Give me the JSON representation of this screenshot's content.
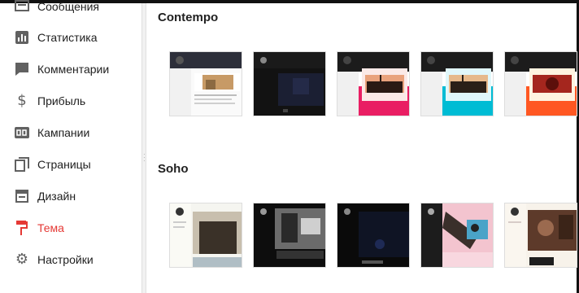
{
  "sidebar": {
    "items": [
      {
        "label": "Сообщения",
        "icon": "message-icon"
      },
      {
        "label": "Статистика",
        "icon": "stats-icon"
      },
      {
        "label": "Комментарии",
        "icon": "comment-icon"
      },
      {
        "label": "Прибыль",
        "icon": "dollar-icon"
      },
      {
        "label": "Кампании",
        "icon": "ad-icon"
      },
      {
        "label": "Страницы",
        "icon": "pages-icon"
      },
      {
        "label": "Дизайн",
        "icon": "layout-icon"
      },
      {
        "label": "Тема",
        "icon": "paint-roller-icon",
        "active": true
      },
      {
        "label": "Настройки",
        "icon": "gear-icon"
      }
    ]
  },
  "colors": {
    "accent": "#e53935",
    "icon": "#616161"
  },
  "sections": [
    {
      "title": "Contempo",
      "thumbnails": [
        "contempo-light",
        "contempo-dark",
        "contempo-pink",
        "contempo-aqua",
        "contempo-vermilion"
      ]
    },
    {
      "title": "Soho",
      "thumbnails": [
        "soho-light",
        "soho-dark",
        "soho-midnight",
        "soho-pink",
        "soho-brown"
      ]
    }
  ]
}
